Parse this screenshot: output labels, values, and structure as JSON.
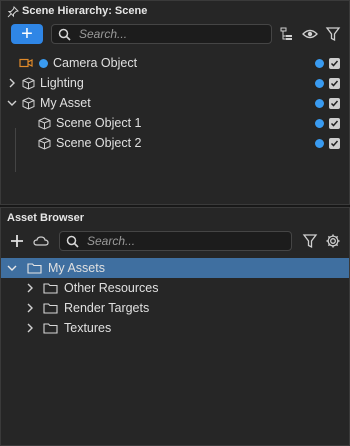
{
  "scene_panel": {
    "title": "Scene Hierarchy: Scene",
    "add_label": "+",
    "search_placeholder": "Search...",
    "items": [
      {
        "label": "Camera Object",
        "icon": "camera-icon",
        "expandable": false,
        "visible": true,
        "enabled": true
      },
      {
        "label": "Lighting",
        "icon": "cube-icon",
        "expandable": true,
        "expanded": false,
        "visible": true,
        "enabled": true
      },
      {
        "label": "My Asset",
        "icon": "cube-icon",
        "expandable": true,
        "expanded": true,
        "visible": true,
        "enabled": true
      },
      {
        "label": "Scene Object 1",
        "icon": "cube-icon",
        "expandable": false,
        "visible": true,
        "enabled": true
      },
      {
        "label": "Scene Object 2",
        "icon": "cube-icon",
        "expandable": false,
        "visible": true,
        "enabled": true
      }
    ]
  },
  "asset_panel": {
    "title": "Asset Browser",
    "search_placeholder": "Search...",
    "items": [
      {
        "label": "My Assets",
        "expanded": true,
        "selected": true
      },
      {
        "label": "Other Resources",
        "expanded": false,
        "selected": false
      },
      {
        "label": "Render Targets",
        "expanded": false,
        "selected": false
      },
      {
        "label": "Textures",
        "expanded": false,
        "selected": false
      }
    ]
  },
  "colors": {
    "accent": "#2f86e6",
    "selection": "#3f6fa0",
    "camera_icon": "#e08a2a",
    "visibility_dot": "#3a9bf0"
  }
}
